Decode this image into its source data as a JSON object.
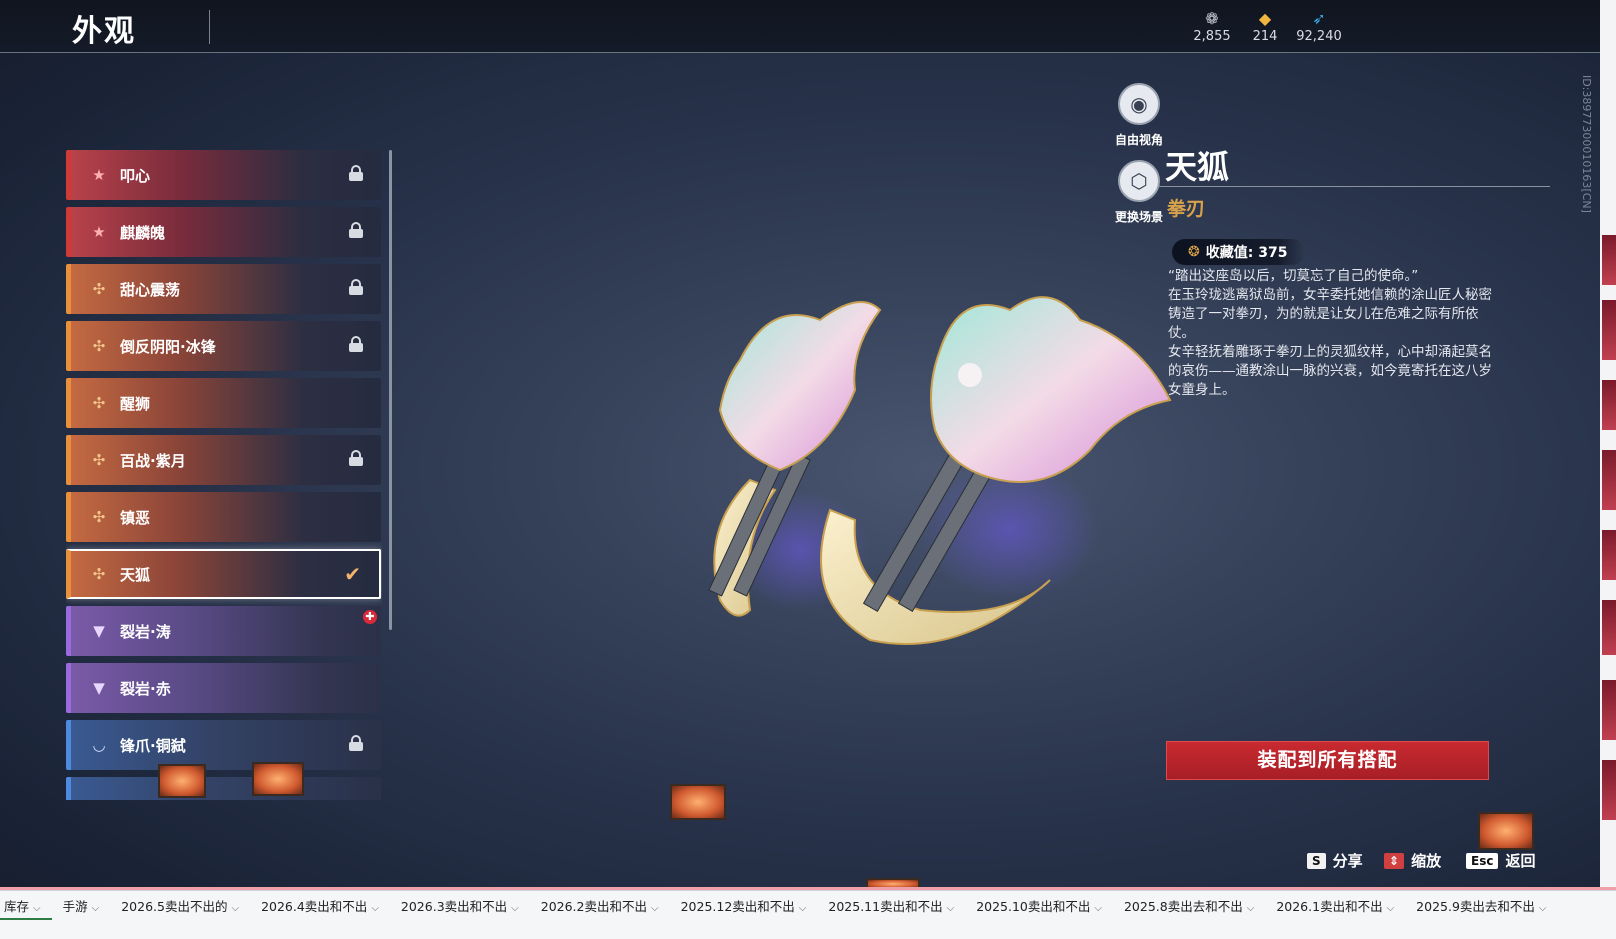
{
  "header": {
    "title": "外观"
  },
  "currencies": [
    {
      "icon": "gem-icon",
      "glyph": "❁",
      "value": "2,855",
      "color": "#c8ccd6"
    },
    {
      "icon": "ticket-icon",
      "glyph": "◆",
      "value": "214",
      "color": "#f2b640"
    },
    {
      "icon": "feather-icon",
      "glyph": "➶",
      "value": "92,240",
      "color": "#3aa8e8"
    }
  ],
  "items": [
    {
      "label": "叩心",
      "rarity": "red",
      "icon": "★",
      "locked": true
    },
    {
      "label": "麒麟魄",
      "rarity": "red",
      "icon": "★",
      "locked": true
    },
    {
      "label": "甜心震荡",
      "rarity": "gold",
      "icon": "✣",
      "locked": true
    },
    {
      "label": "倒反阴阳·冰锋",
      "rarity": "gold",
      "icon": "✣",
      "locked": true
    },
    {
      "label": "醒狮",
      "rarity": "gold",
      "icon": "✣",
      "locked": false
    },
    {
      "label": "百战·紫月",
      "rarity": "gold",
      "icon": "✣",
      "locked": true
    },
    {
      "label": "镇恶",
      "rarity": "gold",
      "icon": "✣",
      "locked": false
    },
    {
      "label": "天狐",
      "rarity": "gold",
      "icon": "✣",
      "locked": false,
      "selected": true
    },
    {
      "label": "裂岩·涛",
      "rarity": "purple",
      "icon": "▼",
      "locked": false,
      "new": true
    },
    {
      "label": "裂岩·赤",
      "rarity": "purple",
      "icon": "▼",
      "locked": false
    },
    {
      "label": "锋爪·铜弑",
      "rarity": "blue",
      "icon": "◡",
      "locked": true
    }
  ],
  "side_buttons": [
    {
      "label": "自由视角",
      "icon": "camera-icon",
      "glyph": "◉"
    },
    {
      "label": "更换场景",
      "icon": "cube-icon",
      "glyph": "⬡"
    }
  ],
  "detail": {
    "name": "天狐",
    "type": "拳刃",
    "collect_label": "收藏值: 375",
    "description": [
      "“踏出这座岛以后，切莫忘了自己的使命。”",
      "在玉玲珑逃离狱岛前，女辛委托她信赖的涂山匠人秘密铸造了一对拳刃，为的就是让女儿在危难之际有所依仗。",
      "女辛轻抚着雕琢于拳刃上的灵狐纹样，心中却涌起莫名的哀伤——通教涂山一脉的兴衰，如今竟寄托在这八岁女童身上。"
    ],
    "equip_button": "装配到所有搭配"
  },
  "hotkeys": [
    {
      "key": "S",
      "label": "分享"
    },
    {
      "key": "⇕",
      "label": "缩放"
    },
    {
      "key": "Esc",
      "label": "返回"
    }
  ],
  "id_text": "ID:38977300010163[CN]",
  "taskbar": {
    "tabs": [
      "库存",
      "手游",
      "2026.5卖出不出的",
      "2026.4卖出和不出",
      "2026.3卖出和不出",
      "2026.2卖出和不出",
      "2025.12卖出和不出",
      "2025.11卖出和不出",
      "2025.10卖出和不出",
      "2025.8卖出去和不出",
      "2026.1卖出和不出",
      "2025.9卖出去和不出"
    ]
  }
}
